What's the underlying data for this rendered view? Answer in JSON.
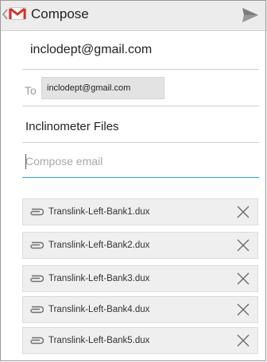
{
  "header": {
    "title": "Compose",
    "icons": {
      "back": "chevron-left-icon",
      "app": "gmail-icon",
      "send": "send-icon"
    },
    "app_icon_color": "#d93025"
  },
  "compose": {
    "from": "inclodept@gmail.com",
    "to_label": "To",
    "to_recipients": [
      "inclodept@gmail.com"
    ],
    "subject": "Inclinometer Files",
    "body_value": "",
    "body_placeholder": "Compose email",
    "focus_color": "#2a9fd6"
  },
  "attachments": [
    {
      "name": "Translink-Left-Bank1.dux"
    },
    {
      "name": "Translink-Left-Bank2.dux"
    },
    {
      "name": "Translink-Left-Bank3.dux"
    },
    {
      "name": "Translink-Left-Bank4.dux"
    },
    {
      "name": "Translink-Left-Bank5.dux"
    }
  ],
  "attachment_icons": {
    "file": "paperclip-icon",
    "remove": "close-icon"
  }
}
